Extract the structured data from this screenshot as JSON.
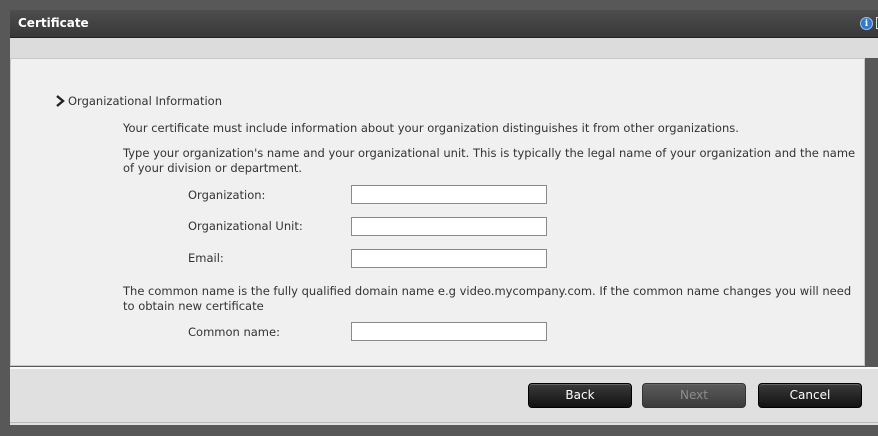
{
  "dialog": {
    "title": "Certificate",
    "header_icons": [
      "info-icon",
      "close-icon"
    ]
  },
  "section": {
    "title": "Organizational Information",
    "intro": "Your certificate must include information about your organization distinguishes it from other organizations.",
    "instructions": "Type your organization's name and your organizational unit. This is typically the legal name of your organization and the name of your division or department."
  },
  "form": {
    "organization": {
      "label": "Organization:",
      "value": ""
    },
    "organizational_unit": {
      "label": "Organizational Unit:",
      "value": ""
    },
    "email": {
      "label": "Email:",
      "value": ""
    },
    "common_name_note": "The common name is the fully qualified domain name e.g video.mycompany.com. If the common name changes you will need to obtain new certificate",
    "common_name": {
      "label": "Common name:",
      "value": ""
    }
  },
  "buttons": {
    "back": "Back",
    "next": "Next",
    "cancel": "Cancel"
  }
}
